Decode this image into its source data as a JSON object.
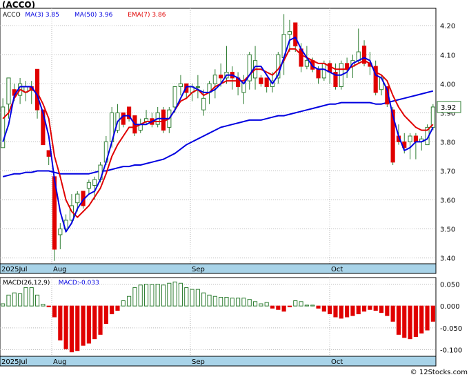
{
  "header": {
    "title": "(ACCO)"
  },
  "watermark": "© 12Stocks.com",
  "colors": {
    "up": "#2e7d32",
    "down": "#e00000",
    "ma_blue": "#0000e0",
    "ema_red": "#e00000",
    "axis_band": "#a8d3e8"
  },
  "chart_data": [
    {
      "type": "candlestick",
      "ticker": "ACCO",
      "legend": [
        {
          "label": "ACCO",
          "color": "#000000"
        },
        {
          "label": "MA(3)",
          "value": "3.85",
          "color": "#0000e0"
        },
        {
          "label": "MA(50)",
          "value": "3.96",
          "color": "#0000e0"
        },
        {
          "label": "EMA(7)",
          "value": "3.86",
          "color": "#e00000"
        }
      ],
      "y_ticks": [
        "4.20",
        "4.10",
        "4.00",
        "3.90",
        "3.80",
        "3.70",
        "3.60",
        "3.50",
        "3.40"
      ],
      "ylim": [
        3.38,
        4.26
      ],
      "x_labels": [
        "2025Jul",
        "Aug",
        "Sep",
        "Oct"
      ],
      "last_price": "3.92",
      "candles": [
        {
          "o": 3.78,
          "h": 3.95,
          "l": 3.78,
          "c": 3.92
        },
        {
          "o": 3.93,
          "h": 4.02,
          "l": 3.88,
          "c": 4.02
        },
        {
          "o": 3.98,
          "h": 4.0,
          "l": 3.94,
          "c": 3.96
        },
        {
          "o": 3.96,
          "h": 4.02,
          "l": 3.93,
          "c": 4.0
        },
        {
          "o": 3.97,
          "h": 4.01,
          "l": 3.94,
          "c": 3.99
        },
        {
          "o": 3.99,
          "h": 4.01,
          "l": 3.93,
          "c": 3.98
        },
        {
          "o": 4.05,
          "h": 4.05,
          "l": 3.88,
          "c": 3.91
        },
        {
          "o": 3.91,
          "h": 3.91,
          "l": 3.79,
          "c": 3.79
        },
        {
          "o": 3.77,
          "h": 3.77,
          "l": 3.72,
          "c": 3.75
        },
        {
          "o": 3.68,
          "h": 3.68,
          "l": 3.39,
          "c": 3.43
        },
        {
          "o": 3.48,
          "h": 3.52,
          "l": 3.43,
          "c": 3.5
        },
        {
          "o": 3.5,
          "h": 3.55,
          "l": 3.49,
          "c": 3.53
        },
        {
          "o": 3.53,
          "h": 3.62,
          "l": 3.52,
          "c": 3.58
        },
        {
          "o": 3.59,
          "h": 3.63,
          "l": 3.56,
          "c": 3.62
        },
        {
          "o": 3.63,
          "h": 3.63,
          "l": 3.57,
          "c": 3.58
        },
        {
          "o": 3.64,
          "h": 3.67,
          "l": 3.62,
          "c": 3.66
        },
        {
          "o": 3.65,
          "h": 3.68,
          "l": 3.6,
          "c": 3.67
        },
        {
          "o": 3.67,
          "h": 3.73,
          "l": 3.66,
          "c": 3.72
        },
        {
          "o": 3.73,
          "h": 3.82,
          "l": 3.72,
          "c": 3.8
        },
        {
          "o": 3.8,
          "h": 3.92,
          "l": 3.78,
          "c": 3.9
        },
        {
          "o": 3.84,
          "h": 3.93,
          "l": 3.83,
          "c": 3.9
        },
        {
          "o": 3.9,
          "h": 3.9,
          "l": 3.85,
          "c": 3.86
        },
        {
          "o": 3.92,
          "h": 3.92,
          "l": 3.87,
          "c": 3.88
        },
        {
          "o": 3.89,
          "h": 3.89,
          "l": 3.82,
          "c": 3.83
        },
        {
          "o": 3.84,
          "h": 3.88,
          "l": 3.83,
          "c": 3.86
        },
        {
          "o": 3.87,
          "h": 3.91,
          "l": 3.86,
          "c": 3.88
        },
        {
          "o": 3.88,
          "h": 3.9,
          "l": 3.85,
          "c": 3.86
        },
        {
          "o": 3.86,
          "h": 3.92,
          "l": 3.85,
          "c": 3.9
        },
        {
          "o": 3.91,
          "h": 3.92,
          "l": 3.83,
          "c": 3.84
        },
        {
          "o": 3.85,
          "h": 3.92,
          "l": 3.83,
          "c": 3.91
        },
        {
          "o": 3.92,
          "h": 3.99,
          "l": 3.9,
          "c": 3.99
        },
        {
          "o": 3.99,
          "h": 4.03,
          "l": 3.96,
          "c": 4.0
        },
        {
          "o": 4.0,
          "h": 4.0,
          "l": 3.95,
          "c": 3.97
        },
        {
          "o": 3.97,
          "h": 4.0,
          "l": 3.94,
          "c": 3.99
        },
        {
          "o": 3.99,
          "h": 4.03,
          "l": 3.95,
          "c": 3.99
        },
        {
          "o": 3.91,
          "h": 3.98,
          "l": 3.89,
          "c": 3.95
        },
        {
          "o": 3.97,
          "h": 4.01,
          "l": 3.93,
          "c": 4.0
        },
        {
          "o": 4.0,
          "h": 4.05,
          "l": 3.95,
          "c": 4.03
        },
        {
          "o": 4.03,
          "h": 4.07,
          "l": 3.99,
          "c": 4.02
        },
        {
          "o": 4.02,
          "h": 4.13,
          "l": 4.0,
          "c": 4.04
        },
        {
          "o": 4.04,
          "h": 4.06,
          "l": 3.98,
          "c": 4.02
        },
        {
          "o": 4.02,
          "h": 4.04,
          "l": 3.96,
          "c": 3.99
        },
        {
          "o": 3.97,
          "h": 4.03,
          "l": 3.93,
          "c": 4.01
        },
        {
          "o": 4.01,
          "h": 4.11,
          "l": 3.98,
          "c": 4.1
        },
        {
          "o": 4.02,
          "h": 4.13,
          "l": 3.98,
          "c": 4.08
        },
        {
          "o": 4.02,
          "h": 4.03,
          "l": 3.99,
          "c": 4.0
        },
        {
          "o": 4.02,
          "h": 4.02,
          "l": 3.97,
          "c": 3.99
        },
        {
          "o": 3.99,
          "h": 4.04,
          "l": 3.97,
          "c": 4.01
        },
        {
          "o": 4.02,
          "h": 4.11,
          "l": 4.0,
          "c": 4.1
        },
        {
          "o": 4.09,
          "h": 4.24,
          "l": 4.03,
          "c": 4.17
        },
        {
          "o": 4.17,
          "h": 4.22,
          "l": 4.11,
          "c": 4.18
        },
        {
          "o": 4.21,
          "h": 4.21,
          "l": 4.11,
          "c": 4.13
        },
        {
          "o": 4.12,
          "h": 4.14,
          "l": 4.04,
          "c": 4.06
        },
        {
          "o": 4.06,
          "h": 4.13,
          "l": 4.05,
          "c": 4.08
        },
        {
          "o": 4.08,
          "h": 4.09,
          "l": 4.04,
          "c": 4.05
        },
        {
          "o": 4.05,
          "h": 4.06,
          "l": 4.0,
          "c": 4.02
        },
        {
          "o": 4.02,
          "h": 4.08,
          "l": 4.01,
          "c": 4.07
        },
        {
          "o": 4.07,
          "h": 4.08,
          "l": 4.0,
          "c": 4.04
        },
        {
          "o": 4.04,
          "h": 4.07,
          "l": 3.98,
          "c": 3.99
        },
        {
          "o": 3.99,
          "h": 4.08,
          "l": 3.98,
          "c": 4.07
        },
        {
          "o": 4.07,
          "h": 4.09,
          "l": 4.02,
          "c": 4.05
        },
        {
          "o": 4.06,
          "h": 4.1,
          "l": 4.02,
          "c": 4.08
        },
        {
          "o": 4.08,
          "h": 4.19,
          "l": 4.07,
          "c": 4.11
        },
        {
          "o": 4.13,
          "h": 4.15,
          "l": 4.06,
          "c": 4.07
        },
        {
          "o": 4.07,
          "h": 4.11,
          "l": 4.03,
          "c": 4.06
        },
        {
          "o": 4.06,
          "h": 4.08,
          "l": 3.96,
          "c": 3.97
        },
        {
          "o": 3.98,
          "h": 4.03,
          "l": 3.96,
          "c": 4.02
        },
        {
          "o": 3.99,
          "h": 3.99,
          "l": 3.92,
          "c": 3.93
        },
        {
          "o": 3.91,
          "h": 3.92,
          "l": 3.72,
          "c": 3.73
        },
        {
          "o": 3.82,
          "h": 3.86,
          "l": 3.79,
          "c": 3.8
        },
        {
          "o": 3.8,
          "h": 3.83,
          "l": 3.76,
          "c": 3.78
        },
        {
          "o": 3.8,
          "h": 3.83,
          "l": 3.74,
          "c": 3.82
        },
        {
          "o": 3.82,
          "h": 3.83,
          "l": 3.74,
          "c": 3.8
        },
        {
          "o": 3.8,
          "h": 3.82,
          "l": 3.77,
          "c": 3.81
        },
        {
          "o": 3.79,
          "h": 3.86,
          "l": 3.79,
          "c": 3.85
        },
        {
          "o": 3.85,
          "h": 3.93,
          "l": 3.84,
          "c": 3.92
        }
      ],
      "ma3": [
        3.8,
        3.86,
        3.96,
        3.99,
        3.99,
        3.99,
        3.96,
        3.9,
        3.82,
        3.67,
        3.56,
        3.49,
        3.52,
        3.57,
        3.6,
        3.62,
        3.63,
        3.67,
        3.73,
        3.8,
        3.87,
        3.89,
        3.89,
        3.86,
        3.86,
        3.86,
        3.87,
        3.88,
        3.88,
        3.88,
        3.91,
        3.95,
        3.99,
        3.99,
        3.98,
        3.97,
        3.97,
        3.98,
        4.0,
        4.03,
        4.03,
        4.02,
        4.0,
        4.03,
        4.06,
        4.06,
        4.03,
        4.0,
        4.03,
        4.09,
        4.15,
        4.16,
        4.12,
        4.09,
        4.06,
        4.05,
        4.05,
        4.04,
        4.03,
        4.03,
        4.04,
        4.07,
        4.08,
        4.09,
        4.08,
        4.03,
        4.02,
        3.98,
        3.89,
        3.82,
        3.77,
        3.78,
        3.8,
        3.8,
        3.81,
        3.85
      ],
      "ma50": [
        3.68,
        3.685,
        3.69,
        3.69,
        3.695,
        3.695,
        3.7,
        3.7,
        3.7,
        3.695,
        3.69,
        3.69,
        3.69,
        3.69,
        3.69,
        3.69,
        3.695,
        3.7,
        3.7,
        3.705,
        3.71,
        3.715,
        3.715,
        3.72,
        3.72,
        3.725,
        3.73,
        3.735,
        3.74,
        3.75,
        3.76,
        3.775,
        3.79,
        3.8,
        3.81,
        3.82,
        3.83,
        3.84,
        3.85,
        3.855,
        3.86,
        3.865,
        3.87,
        3.875,
        3.875,
        3.875,
        3.88,
        3.885,
        3.89,
        3.89,
        3.895,
        3.9,
        3.905,
        3.91,
        3.915,
        3.92,
        3.925,
        3.93,
        3.93,
        3.935,
        3.935,
        3.935,
        3.935,
        3.935,
        3.935,
        3.93,
        3.93,
        3.935,
        3.94,
        3.945,
        3.95,
        3.955,
        3.96,
        3.965,
        3.97,
        3.975
      ],
      "ema7": [
        3.88,
        3.9,
        3.95,
        3.98,
        3.97,
        3.98,
        3.97,
        3.93,
        3.88,
        3.75,
        3.68,
        3.6,
        3.56,
        3.54,
        3.56,
        3.58,
        3.61,
        3.64,
        3.69,
        3.75,
        3.79,
        3.82,
        3.85,
        3.85,
        3.86,
        3.87,
        3.87,
        3.87,
        3.87,
        3.88,
        3.91,
        3.94,
        3.95,
        3.97,
        3.98,
        3.96,
        3.97,
        3.99,
        4.0,
        4.01,
        4.01,
        4.01,
        4.01,
        4.03,
        4.05,
        4.05,
        4.04,
        4.03,
        4.05,
        4.08,
        4.12,
        4.12,
        4.1,
        4.09,
        4.08,
        4.07,
        4.07,
        4.06,
        4.05,
        4.05,
        4.05,
        4.06,
        4.07,
        4.08,
        4.07,
        4.04,
        4.03,
        4.01,
        3.96,
        3.92,
        3.89,
        3.87,
        3.85,
        3.84,
        3.84,
        3.86
      ]
    },
    {
      "type": "bar",
      "title": "MACD(26,12,9)",
      "legend": [
        {
          "label": "MACD(26,12,9)",
          "color": "#000000"
        },
        {
          "label": "MACD:-0.033",
          "color": "#0000e0"
        }
      ],
      "y_ticks": [
        "0.050",
        "0.000",
        "-0.050",
        "-0.100"
      ],
      "ylim": [
        -0.115,
        0.065
      ],
      "x_labels": [
        "2025Jul",
        "Aug",
        "Sep",
        "Oct"
      ],
      "values": [
        0.005,
        0.025,
        0.03,
        0.028,
        0.042,
        0.042,
        0.025,
        0.004,
        -0.002,
        -0.025,
        -0.078,
        -0.098,
        -0.105,
        -0.102,
        -0.09,
        -0.085,
        -0.075,
        -0.065,
        -0.04,
        -0.018,
        -0.01,
        0.012,
        0.022,
        0.042,
        0.048,
        0.05,
        0.049,
        0.05,
        0.048,
        0.052,
        0.055,
        0.052,
        0.042,
        0.038,
        0.038,
        0.03,
        0.025,
        0.022,
        0.02,
        0.02,
        0.018,
        0.018,
        0.018,
        0.015,
        0.01,
        0.005,
        0.008,
        -0.005,
        -0.008,
        -0.012,
        -0.002,
        0.012,
        0.01,
        0.002,
        0.002,
        -0.005,
        -0.012,
        -0.018,
        -0.025,
        -0.028,
        -0.025,
        -0.022,
        -0.018,
        -0.012,
        -0.008,
        -0.01,
        -0.015,
        -0.022,
        -0.035,
        -0.065,
        -0.072,
        -0.075,
        -0.07,
        -0.062,
        -0.055,
        -0.035
      ]
    }
  ]
}
